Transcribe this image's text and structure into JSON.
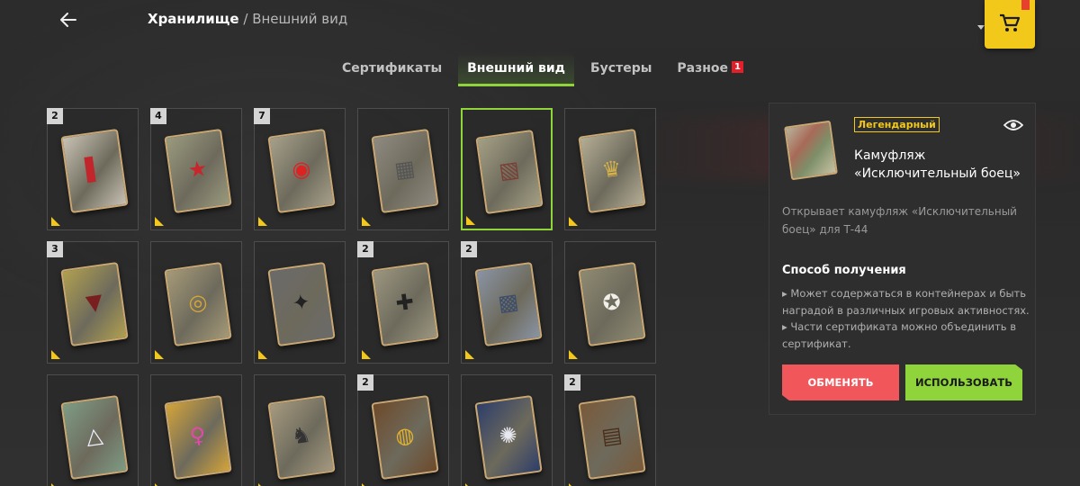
{
  "header": {
    "breadcrumb_current": "Хранилище",
    "breadcrumb_separator": "/",
    "breadcrumb_sub": "Внешний вид"
  },
  "tabs": [
    {
      "label": "Сертификаты",
      "active": false
    },
    {
      "label": "Внешний вид",
      "active": true
    },
    {
      "label": "Бустеры",
      "active": false
    },
    {
      "label": "Разное",
      "active": false,
      "badge": "1"
    }
  ],
  "grid": {
    "items": [
      {
        "count": "2",
        "emblem": "flag-stripes",
        "theme": "#c8c2b4"
      },
      {
        "count": "4",
        "emblem": "red-star",
        "theme": "#9a9a7e"
      },
      {
        "count": "7",
        "emblem": "roundel",
        "theme": "#a6a08a"
      },
      {
        "count": "",
        "emblem": "splinter-camo",
        "theme": "#8f8a80"
      },
      {
        "count": "",
        "emblem": "exceptional-fighter-camo",
        "theme": "#a4a085",
        "selected": true
      },
      {
        "count": "",
        "emblem": "double-eagle",
        "theme": "#b5ae95"
      },
      {
        "count": "3",
        "emblem": "shark-mouth",
        "theme": "#b0a050"
      },
      {
        "count": "",
        "emblem": "gold-medal",
        "theme": "#a69a78"
      },
      {
        "count": "",
        "emblem": "raven",
        "theme": "#6a6a6a"
      },
      {
        "count": "2",
        "emblem": "number-32-cross",
        "theme": "#9c9680"
      },
      {
        "count": "2",
        "emblem": "blue-camo",
        "theme": "#8a94a4"
      },
      {
        "count": "",
        "emblem": "white-star",
        "theme": "#8e8a72"
      },
      {
        "count": "",
        "emblem": "triangle-sign",
        "theme": "#7e9c84"
      },
      {
        "count": "",
        "emblem": "anime-girl",
        "theme": "#d4a43a"
      },
      {
        "count": "",
        "emblem": "wolf-head",
        "theme": "#a69a80"
      },
      {
        "count": "2",
        "emblem": "gold-eyes",
        "theme": "#6e4a2a"
      },
      {
        "count": "",
        "emblem": "dragon-circle",
        "theme": "#2e3e6a"
      },
      {
        "count": "2",
        "emblem": "brick-camo",
        "theme": "#7a5a3a"
      }
    ]
  },
  "panel": {
    "rarity": "Легендарный",
    "name_line1": "Камуфляж",
    "name_line2": "«Исключительный боец»",
    "description": "Открывает камуфляж «Исключительный боец» для Т-44",
    "section_title": "Способ получения",
    "info_1": "▸ Может содержаться в контейнерах и быть наградой в различных игровых активностях.",
    "info_2": "▸ Части сертификата можно объединить в сертификат.",
    "button_exchange": "ОБМЕНЯТЬ",
    "button_use": "ИСПОЛЬЗОВАТЬ"
  },
  "icons": {
    "back": "arrow-left-icon",
    "shop": "cart-icon",
    "preview": "eye-icon"
  }
}
